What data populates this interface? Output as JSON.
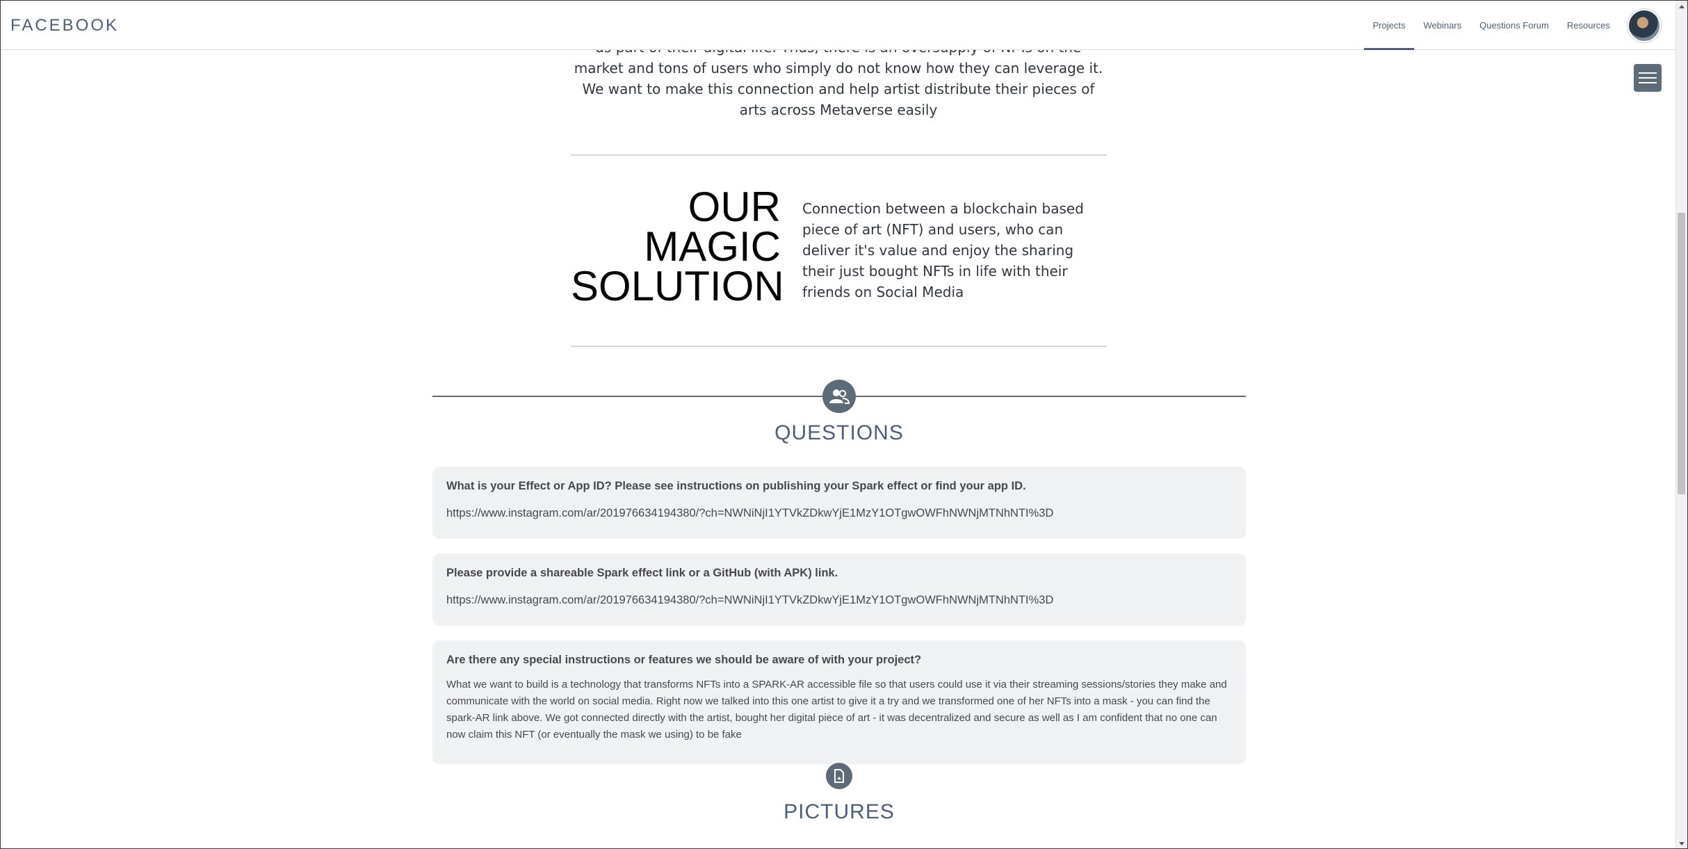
{
  "header": {
    "brand": "FACEBOOK",
    "nav": [
      {
        "label": "Projects",
        "active": true
      },
      {
        "label": "Webinars",
        "active": false
      },
      {
        "label": "Questions Forum",
        "active": false
      },
      {
        "label": "Resources",
        "active": false
      }
    ],
    "avatar_icon": "user-avatar"
  },
  "menu": {
    "icon": "hamburger-menu-icon"
  },
  "intro": {
    "text": "as part of their digital life. Thus, there is an oversupply of NFTs on the market and tons of users who simply do not know how they can leverage it. We want to make this connection and help artist distribute their pieces of arts across Metaverse easily"
  },
  "solution": {
    "title_lines": [
      "OUR",
      "MAGIC",
      "SOLUTION"
    ],
    "text": "Connection between a blockchain based piece of art (NFT) and users, who can deliver it's value and enjoy the sharing their just bought NFTs in life with their friends on Social Media"
  },
  "questions_section": {
    "heading": "QUESTIONS",
    "icon": "users-icon",
    "items": [
      {
        "question": "What is your Effect or App ID?  Please see instructions on publishing your Spark effect or find your app ID.",
        "answer": "https://www.instagram.com/ar/201976634194380/?ch=NWNiNjI1YTVkZDkwYjE1MzY1OTgwOWFhNWNjMTNhNTI%3D"
      },
      {
        "question": "Please provide a shareable Spark effect link or a GitHub (with APK) link.",
        "answer": "https://www.instagram.com/ar/201976634194380/?ch=NWNiNjI1YTVkZDkwYjE1MzY1OTgwOWFhNWNjMTNhNTI%3D"
      },
      {
        "question": "Are there any special instructions or features we should be aware of with your project?",
        "answer": "What we want to build is a technology that transforms NFTs into a SPARK-AR accessible file so that users could use it via their streaming sessions/stories they make and communicate with the world on social media. Right now we talked into this one artist to give it a try and we transformed one of her NFTs into a mask - you can find the spark-AR link above. We got connected directly with the artist, bought her digital piece of art - it was decentralized and secure as well as I am confident that no one can now claim this NFT (or eventually the mask we using) to be fake"
      }
    ]
  },
  "pictures_section": {
    "heading": "PICTURES",
    "icon": "document-image-icon"
  }
}
